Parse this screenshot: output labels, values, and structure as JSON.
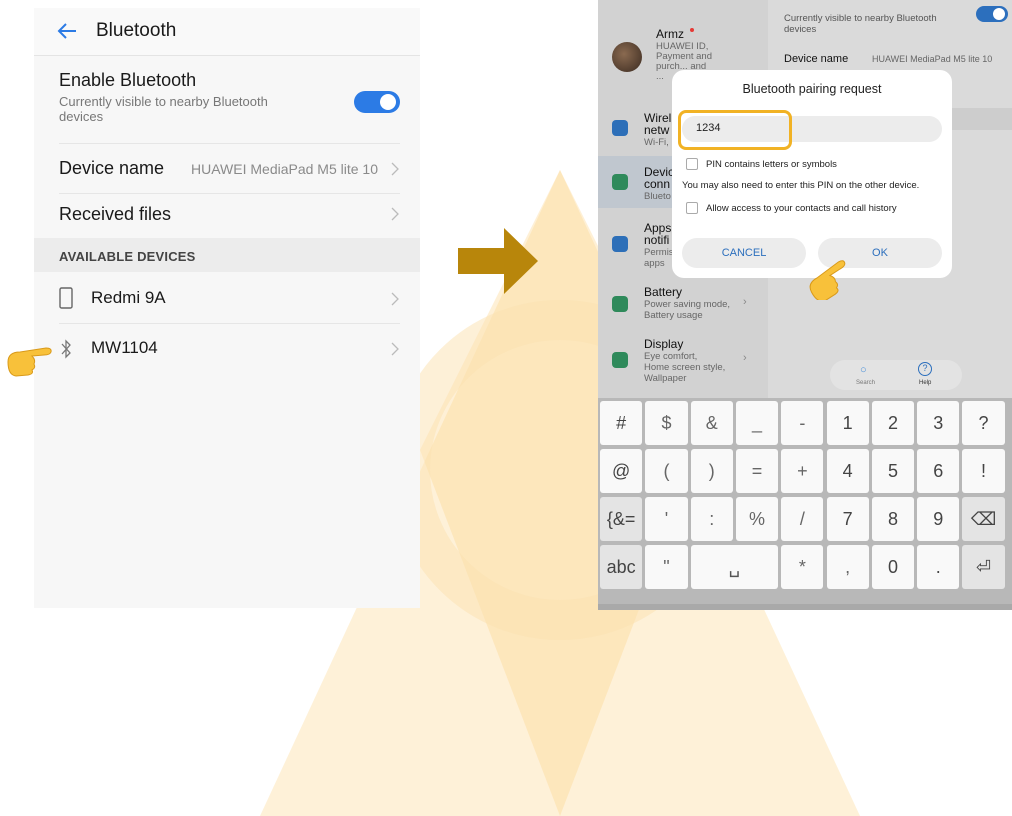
{
  "left_screen": {
    "title": "Bluetooth",
    "enable": {
      "label": "Enable Bluetooth",
      "subtitle": "Currently visible to nearby Bluetooth devices",
      "on": true
    },
    "device_name": {
      "label": "Device name",
      "value": "HUAWEI MediaPad M5 lite 10"
    },
    "received_files": "Received files",
    "section_header": "AVAILABLE DEVICES",
    "devices": [
      {
        "name": "Redmi 9A",
        "icon": "phone-icon"
      },
      {
        "name": "MW1104",
        "icon": "bluetooth-icon"
      }
    ]
  },
  "right_screen": {
    "sidebar": {
      "account": {
        "name": "Armz",
        "sub": "HUAWEI ID, Payment and purch... and ..."
      },
      "items": [
        {
          "title": "Wirel",
          "title2": "netw",
          "sub": "Wi-Fi, I",
          "icon": "wifi-icon"
        },
        {
          "title": "Devic",
          "title2": "conn",
          "sub": "Blueto",
          "icon": "device-connection-icon"
        },
        {
          "title": "Apps",
          "title2": "notifi",
          "sub": "Permis",
          "sub2": "apps",
          "icon": "apps-icon"
        },
        {
          "title": "Battery",
          "sub": "Power saving mode,",
          "sub2": "Battery usage",
          "icon": "battery-icon"
        },
        {
          "title": "Display",
          "sub": "Eye comfort,",
          "sub2": "Home screen style,",
          "sub3": "Wallpaper",
          "icon": "display-icon"
        }
      ]
    },
    "main": {
      "visible_text": "Currently visible to nearby Bluetooth",
      "visible_text2": "devices",
      "device_name_label": "Device name",
      "device_name_value": "HUAWEI MediaPad M5 lite 10",
      "search_label": "Search",
      "help_label": "Help"
    },
    "dialog": {
      "title": "Bluetooth pairing request",
      "pin_value": "1234",
      "opt_letters": "PIN contains letters or symbols",
      "note": "You may also need to enter this PIN on the other device.",
      "opt_contacts": "Allow access to your contacts and call history",
      "cancel": "CANCEL",
      "ok": "OK"
    },
    "keyboard": {
      "row1": [
        "#",
        "$",
        "&",
        "_",
        "-",
        "1",
        "2",
        "3",
        "?"
      ],
      "row2": [
        "@",
        "(",
        ")",
        "=",
        "+",
        "4",
        "5",
        "6",
        "!"
      ],
      "row3": [
        "{&=",
        "'",
        ":",
        "%",
        "/",
        "7",
        "8",
        "9",
        "⌫"
      ],
      "row4": [
        "abc",
        "\"",
        "␣",
        "*",
        ",",
        "0",
        ".",
        "⏎"
      ]
    }
  },
  "colors": {
    "accent": "#2c7be5",
    "highlight": "#f1b224",
    "arrow": "#b8860b"
  }
}
